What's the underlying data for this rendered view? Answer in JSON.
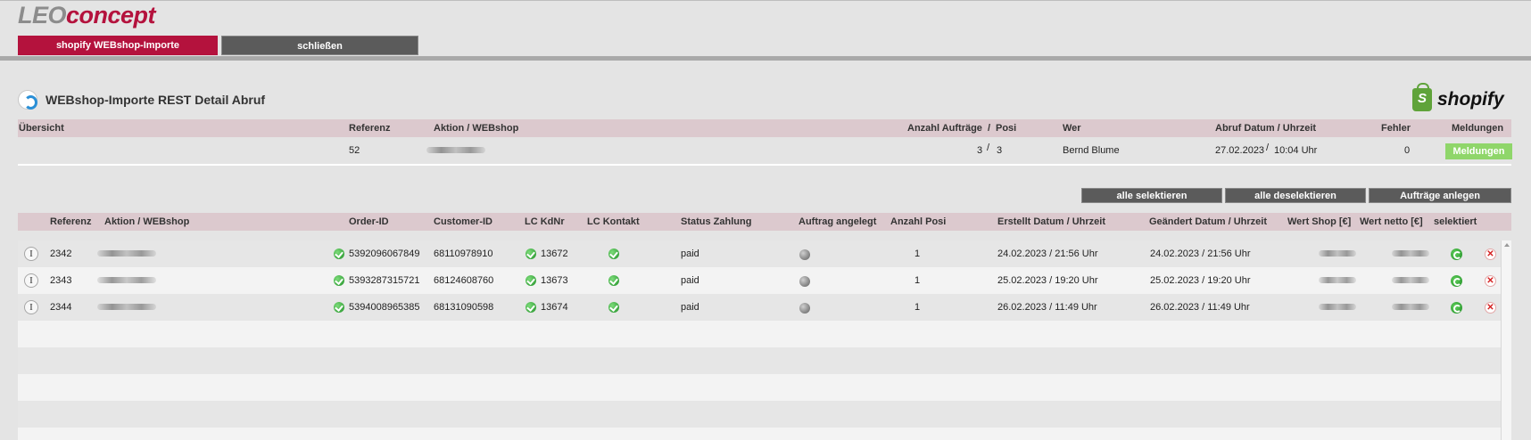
{
  "logo": {
    "part1": "LEO",
    "part2": "concept"
  },
  "tabs": {
    "shopify": "shopify WEBshop-Importe",
    "close": "schließen"
  },
  "title": "WEBshop-Importe REST Detail Abruf",
  "shopify_logo": "shopify",
  "summary": {
    "headers": {
      "overview": "Übersicht",
      "reference": "Referenz",
      "action": "Aktion / WEBshop",
      "orders": "Anzahl Aufträge",
      "slash": "/",
      "posi": "Posi",
      "who": "Wer",
      "date": "Abruf Datum / Uhrzeit",
      "errors": "Fehler",
      "messages": "Meldungen"
    },
    "row": {
      "reference": "52",
      "orders": "3",
      "slash": "/",
      "posi": "3",
      "who": "Bernd Blume",
      "date": "27.02.2023",
      "time_sep": "/",
      "time": "10:04 Uhr",
      "errors": "0",
      "messages_btn": "Meldungen"
    }
  },
  "actions": {
    "select_all": "alle selektieren",
    "deselect_all": "alle deselektieren",
    "create_orders": "Aufträge anlegen"
  },
  "table": {
    "headers": {
      "reference": "Referenz",
      "action": "Aktion / WEBshop",
      "order_id": "Order-ID",
      "customer_id": "Customer-ID",
      "lc_kdnr": "LC KdNr",
      "lc_contact": "LC Kontakt",
      "payment_status": "Status Zahlung",
      "order_created": "Auftrag angelegt",
      "posi_count": "Anzahl Posi",
      "created": "Erstellt Datum / Uhrzeit",
      "changed": "Geändert Datum / Uhrzeit",
      "value_shop": "Wert Shop [€]",
      "value_net": "Wert netto [€]",
      "selected": "selektiert"
    },
    "info_label": "I",
    "delete_label": "✕",
    "rows": [
      {
        "reference": "2342",
        "order_id": "5392096067849",
        "customer_id": "68110978910",
        "lc_kdnr": "13672",
        "payment": "paid",
        "posi": "1",
        "created": "24.02.2023  / 21:56 Uhr",
        "changed": "24.02.2023  / 21:56 Uhr"
      },
      {
        "reference": "2343",
        "order_id": "5393287315721",
        "customer_id": "68124608760",
        "lc_kdnr": "13673",
        "payment": "paid",
        "posi": "1",
        "created": "25.02.2023  / 19:20 Uhr",
        "changed": "25.02.2023  / 19:20 Uhr"
      },
      {
        "reference": "2344",
        "order_id": "5394008965385",
        "customer_id": "68131090598",
        "lc_kdnr": "13674",
        "payment": "paid",
        "posi": "1",
        "created": "26.02.2023  / 11:49 Uhr",
        "changed": "26.02.2023  / 11:49 Uhr"
      }
    ]
  },
  "colors": {
    "brand": "#b4123d",
    "header_band": "#dcc9ce",
    "button": "#5b5b5b",
    "messages_button": "#8fd66a",
    "ok_green": "#2ea336"
  }
}
